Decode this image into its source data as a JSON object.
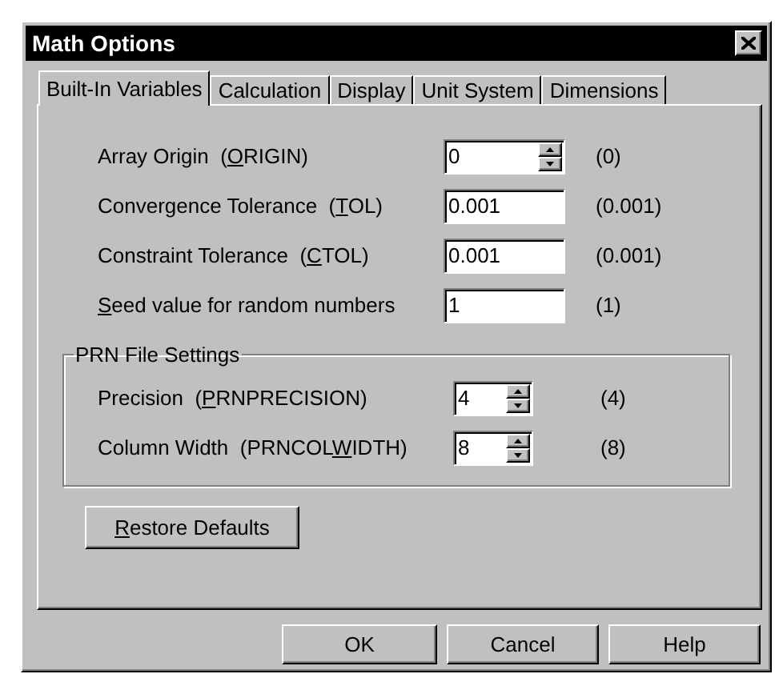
{
  "window": {
    "title": "Math Options"
  },
  "tabs": [
    {
      "label": "Built-In Variables",
      "selected": true
    },
    {
      "label": "Calculation",
      "selected": false
    },
    {
      "label": "Display",
      "selected": false
    },
    {
      "label": "Unit System",
      "selected": false
    },
    {
      "label": "Dimensions",
      "selected": false
    }
  ],
  "settings": [
    {
      "label": {
        "before": "Array Origin  (",
        "key": "O",
        "after": "RIGIN)"
      },
      "kind": "spin",
      "value": "0",
      "default": "(0)"
    },
    {
      "label": {
        "before": "Convergence Tolerance  (",
        "key": "T",
        "after": "OL)"
      },
      "kind": "text",
      "value": "0.001",
      "default": "(0.001)"
    },
    {
      "label": {
        "before": "Constraint Tolerance  (",
        "key": "C",
        "after": "TOL)"
      },
      "kind": "text",
      "value": "0.001",
      "default": "(0.001)"
    },
    {
      "label": {
        "key": "S",
        "after": "eed value for random numbers"
      },
      "kind": "text",
      "value": "1",
      "default": "(1)"
    }
  ],
  "prn_group": {
    "title": "PRN File Settings",
    "settings": [
      {
        "label": {
          "before": "Precision  (",
          "key": "P",
          "after": "RNPRECISION)"
        },
        "kind": "spin",
        "value": "4",
        "default": "(4)"
      },
      {
        "label": {
          "before": "Column Width  (PRNCOL",
          "key": "W",
          "after": "IDTH)"
        },
        "kind": "spin",
        "value": "8",
        "default": "(8)"
      }
    ]
  },
  "restore_button": {
    "key": "R",
    "after": "estore Defaults"
  },
  "buttons": [
    "OK",
    "Cancel",
    "Help"
  ]
}
